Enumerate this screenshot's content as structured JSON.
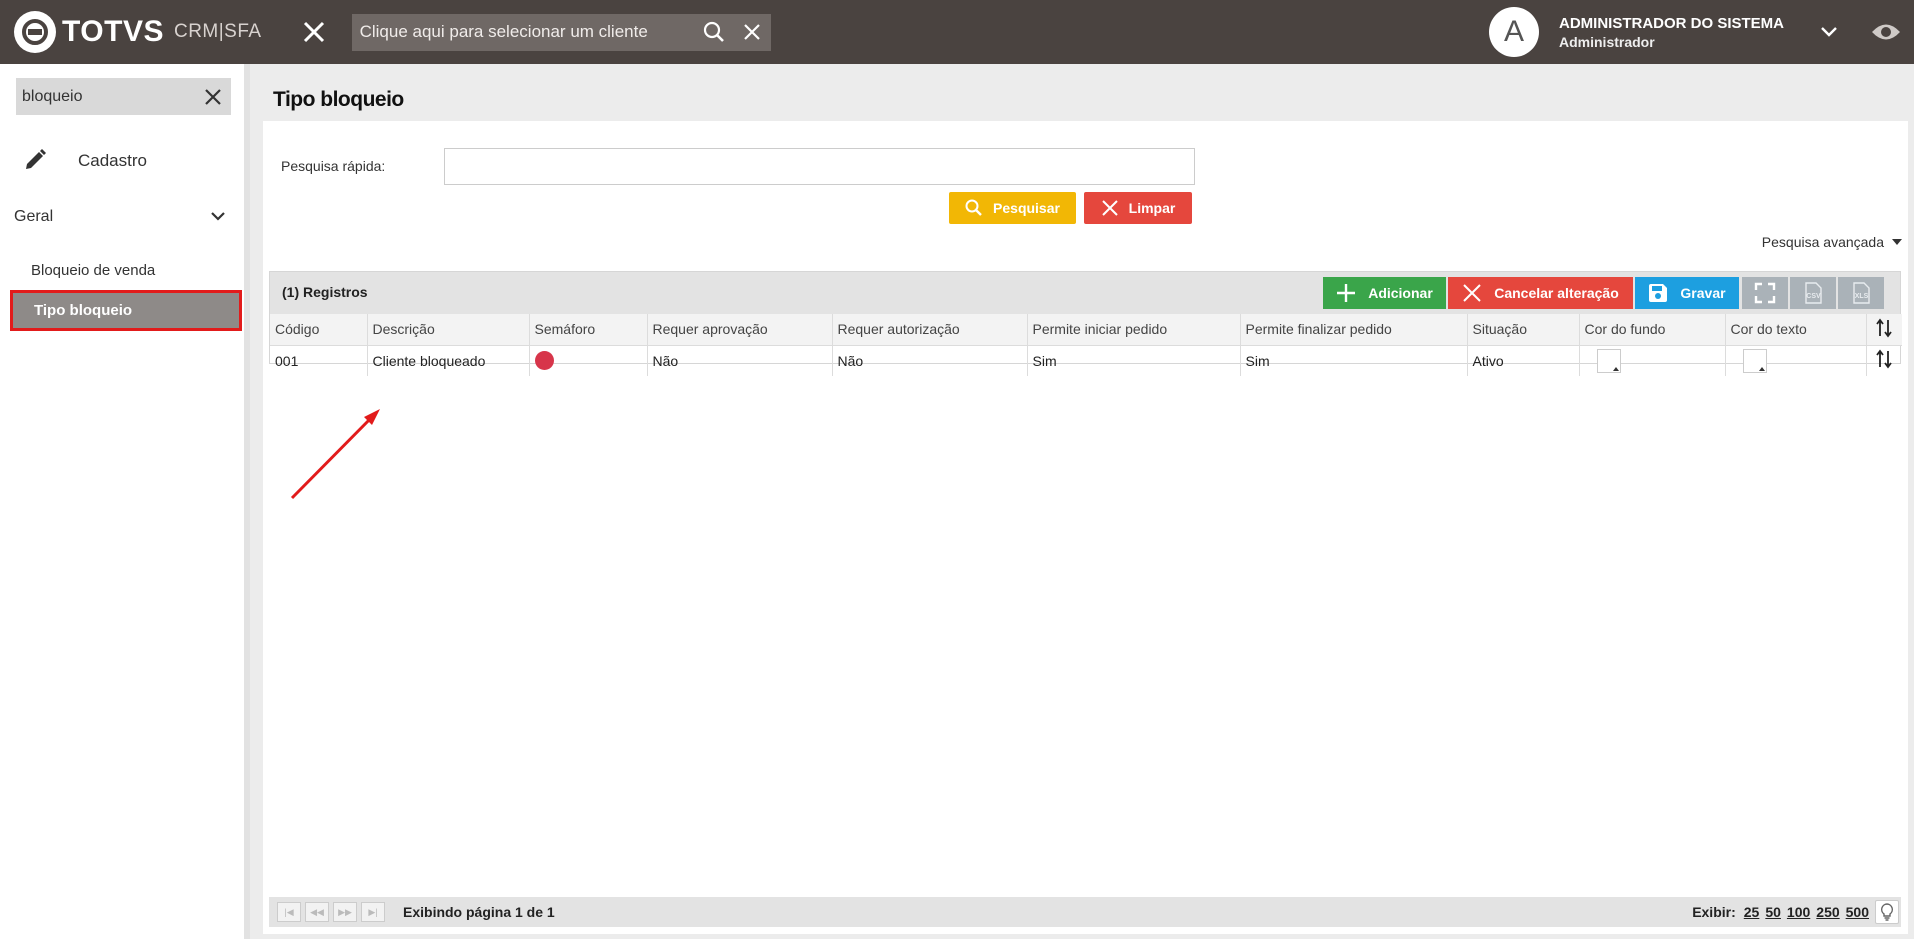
{
  "brand": {
    "logo_text": "TOTVS",
    "product": "CRM|SFA"
  },
  "topbar": {
    "client_search_placeholder": "Clique aqui para selecionar um cliente",
    "user_name": "ADMINISTRADOR DO SISTEMA",
    "user_role": "Administrador",
    "avatar_letter": "A"
  },
  "sidebar": {
    "search_value": "bloqueio",
    "section": "Cadastro",
    "group": "Geral",
    "items": [
      {
        "label": "Bloqueio de venda",
        "active": false
      },
      {
        "label": "Tipo bloqueio",
        "active": true
      }
    ]
  },
  "page": {
    "title": "Tipo bloqueio",
    "quick_search_label": "Pesquisa rápida:",
    "quick_search_value": "",
    "search_button": "Pesquisar",
    "clear_button": "Limpar",
    "advanced_search": "Pesquisa avançada"
  },
  "grid": {
    "records_label": "(1) Registros",
    "toolbar": {
      "add": "Adicionar",
      "cancel": "Cancelar alteração",
      "save": "Gravar",
      "csv": "CSV",
      "xls": "XLS"
    },
    "columns": [
      "Código",
      "Descrição",
      "Semáforo",
      "Requer aprovação",
      "Requer autorização",
      "Permite iniciar pedido",
      "Permite finalizar pedido",
      "Situação",
      "Cor do fundo",
      "Cor do texto"
    ],
    "rows": [
      {
        "codigo": "001",
        "descricao": "Cliente bloqueado",
        "semaforo_color": "#d7354a",
        "requer_aprovacao": "Não",
        "requer_autorizacao": "Não",
        "permite_iniciar": "Sim",
        "permite_finalizar": "Sim",
        "situacao": "Ativo"
      }
    ]
  },
  "pager": {
    "info": "Exibindo página 1 de 1",
    "show_label": "Exibir:",
    "sizes": [
      "25",
      "50",
      "100",
      "250",
      "500"
    ]
  },
  "colors": {
    "topbar": "#4a4340",
    "primary_yellow": "#f2b705",
    "danger_red": "#e5473d",
    "success_green": "#3aa54a",
    "save_blue": "#1d9fe0"
  }
}
